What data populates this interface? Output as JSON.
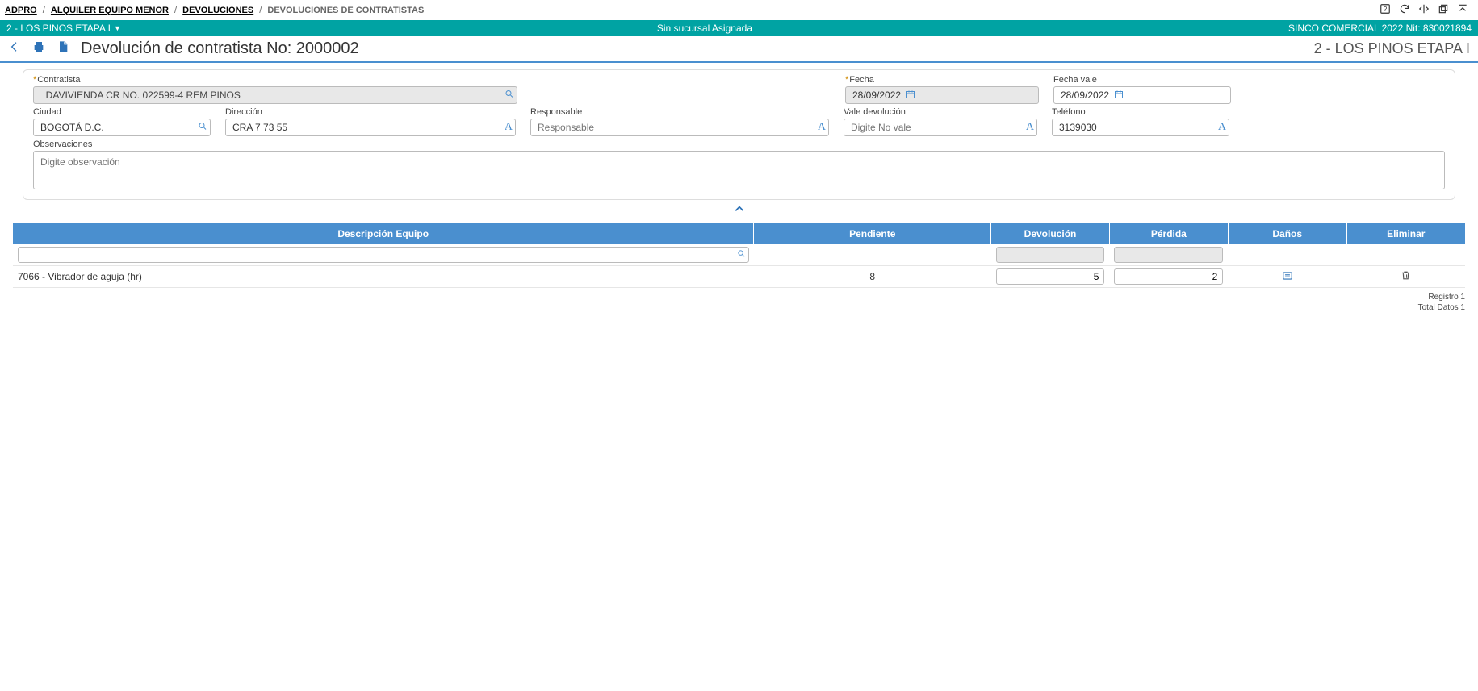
{
  "breadcrumb": {
    "items": [
      "ADPRO",
      "ALQUILER EQUIPO MENOR",
      "DEVOLUCIONES"
    ],
    "current": "DEVOLUCIONES DE CONTRATISTAS"
  },
  "project_bar": {
    "project": "2 - LOS PINOS ETAPA I",
    "center": "Sin sucursal Asignada",
    "right": "SINCO COMERCIAL 2022 Nit: 830021894"
  },
  "title_bar": {
    "title": "Devolución de contratista No: 2000002",
    "right": "2 - LOS PINOS ETAPA I"
  },
  "form": {
    "contratista": {
      "label": "Contratista",
      "value": "DAVIVIENDA CR NO. 022599-4 REM PINOS"
    },
    "fecha": {
      "label": "Fecha",
      "value": "28/09/2022"
    },
    "fecha_vale": {
      "label": "Fecha vale",
      "value": "28/09/2022"
    },
    "ciudad": {
      "label": "Ciudad",
      "value": "BOGOTÁ D.C."
    },
    "direccion": {
      "label": "Dirección",
      "value": "CRA 7 73 55"
    },
    "responsable": {
      "label": "Responsable",
      "placeholder": "Responsable",
      "value": ""
    },
    "vale": {
      "label": "Vale devolución",
      "placeholder": "Digite No vale",
      "value": ""
    },
    "telefono": {
      "label": "Teléfono",
      "value": "3139030"
    },
    "observaciones": {
      "label": "Observaciones",
      "placeholder": "Digite observación",
      "value": ""
    }
  },
  "grid": {
    "headers": {
      "descripcion": "Descripción Equipo",
      "pendiente": "Pendiente",
      "devolucion": "Devolución",
      "perdida": "Pérdida",
      "danos": "Daños",
      "eliminar": "Eliminar"
    },
    "rows": [
      {
        "descripcion": "7066 - Vibrador de aguja (hr)",
        "pendiente": "8",
        "devolucion": "5",
        "perdida": "2"
      }
    ],
    "footer": {
      "registro": "Registro 1",
      "total": "Total Datos 1"
    }
  }
}
